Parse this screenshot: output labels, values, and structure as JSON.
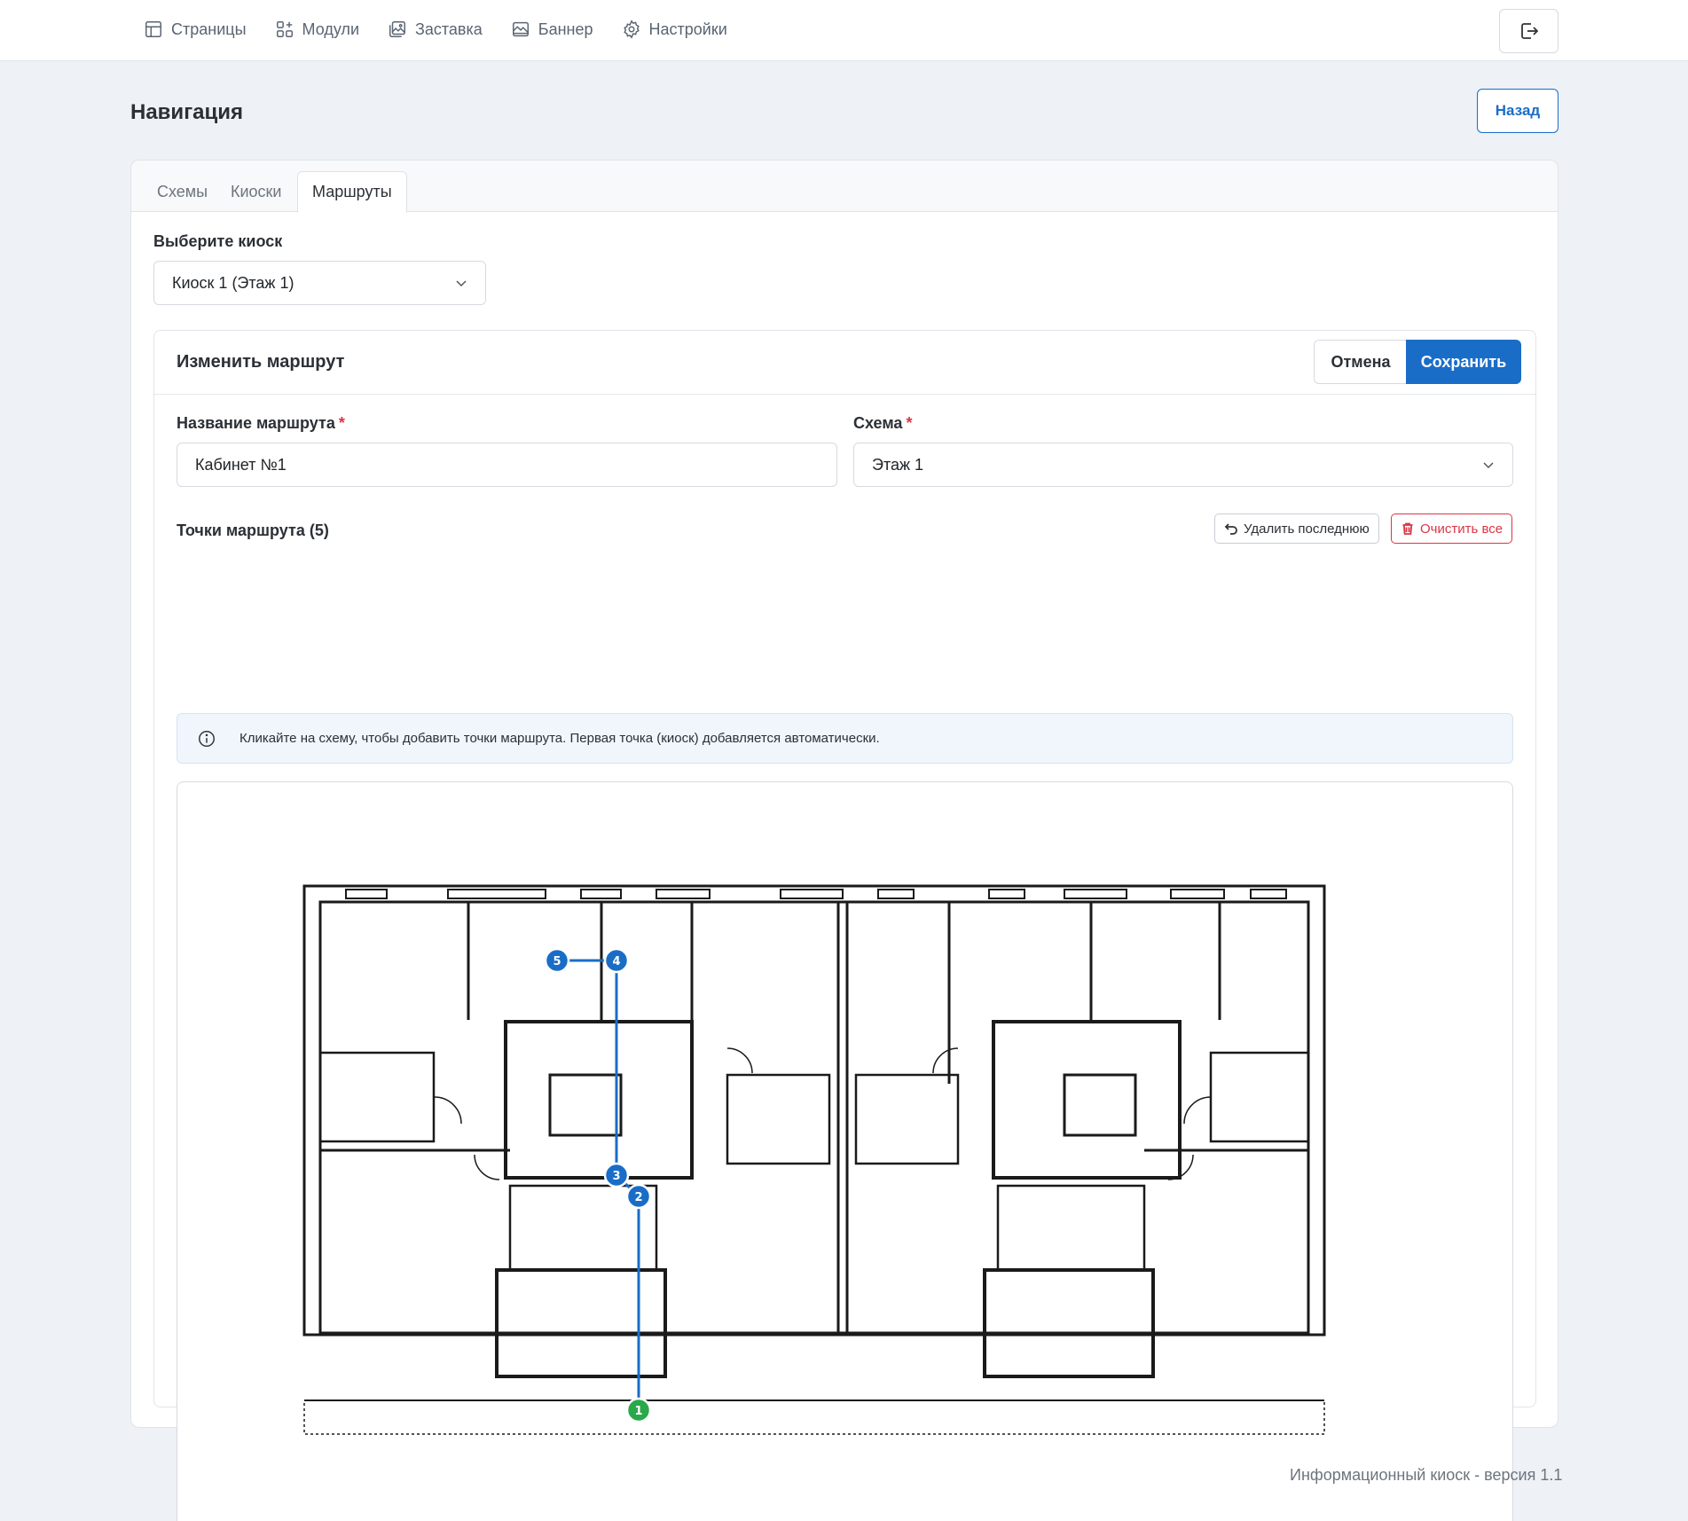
{
  "nav": {
    "items": [
      {
        "label": "Страницы",
        "icon": "table-icon"
      },
      {
        "label": "Модули",
        "icon": "modules-icon"
      },
      {
        "label": "Заставка",
        "icon": "images-icon"
      },
      {
        "label": "Баннер",
        "icon": "banner-icon"
      },
      {
        "label": "Настройки",
        "icon": "gear-icon"
      }
    ]
  },
  "header": {
    "title": "Навигация",
    "back_label": "Назад"
  },
  "tabs": [
    "Схемы",
    "Киоски",
    "Маршруты"
  ],
  "active_tab": "Маршруты",
  "kiosk_select": {
    "label": "Выберите киоск",
    "value": "Киоск 1 (Этаж 1)"
  },
  "route_editor": {
    "title": "Изменить маршрут",
    "cancel_label": "Отмена",
    "save_label": "Сохранить",
    "name_label": "Название маршрута",
    "name_value": "Кабинет №1",
    "scheme_label": "Схема",
    "scheme_value": "Этаж 1",
    "points_label": "Точки маршрута (5)",
    "undo_label": "Удалить последнюю",
    "clear_label": "Очистить все",
    "info_text": "Кликайте на схему, чтобы добавить точки маршрута. Первая точка (киоск) добавляется автоматически.",
    "route_points": [
      {
        "n": "1",
        "kind": "kiosk"
      },
      {
        "n": "2",
        "kind": "waypoint"
      },
      {
        "n": "3",
        "kind": "waypoint"
      },
      {
        "n": "4",
        "kind": "waypoint"
      },
      {
        "n": "5",
        "kind": "waypoint"
      }
    ]
  },
  "colors": {
    "accent": "#1a6dc7",
    "danger": "#dc3545",
    "kiosk_point": "#2aa84a",
    "route_point": "#1a6dc7"
  },
  "footer": {
    "text": "Информационный киоск - версия 1.1"
  }
}
